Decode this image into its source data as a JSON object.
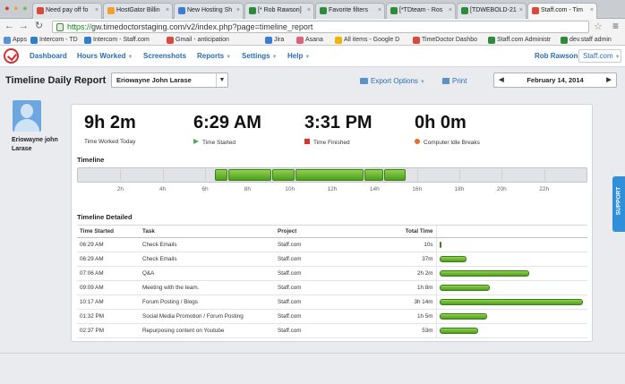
{
  "tabs": [
    {
      "label": "Need pay off fo",
      "color": "#d94a3a",
      "active": false
    },
    {
      "label": "HostGator Billin",
      "color": "#f0a030",
      "active": false
    },
    {
      "label": "New Hosting Sh",
      "color": "#3b7bd6",
      "active": false
    },
    {
      "label": "[* Rob Rawson]",
      "color": "#2e8b3e",
      "active": false
    },
    {
      "label": "Favorite filters",
      "color": "#2e8b3e",
      "active": false
    },
    {
      "label": "[*TDteam - Ros",
      "color": "#2e8b3e",
      "active": false
    },
    {
      "label": "[TDWEBOLD-21",
      "color": "#2e8b3e",
      "active": false
    },
    {
      "label": "Staff.com - Tim",
      "color": "#d94a3a",
      "active": true
    }
  ],
  "address": {
    "scheme": "https://",
    "url": "gw.timedoctorstaging.com/v2/index.php?page=timeline_report"
  },
  "bookmarks": [
    {
      "label": "Apps",
      "color": "#5b8fd6"
    },
    {
      "label": "Intercom - TD",
      "color": "#2f7fcf"
    },
    {
      "label": "Intercom - Staff.com",
      "color": "#2f7fcf"
    },
    {
      "label": "Gmail - anticipation",
      "color": "#d94a3a"
    },
    {
      "label": "Jira",
      "color": "#3b7bd6"
    },
    {
      "label": "Asana",
      "color": "#e0607a"
    },
    {
      "label": "All items - Google D",
      "color": "#f0b400"
    },
    {
      "label": "TimeDoctor Dashbo",
      "color": "#d94a3a"
    },
    {
      "label": "Staff.com Administr",
      "color": "#2e8b3e"
    },
    {
      "label": "dev.staff admin",
      "color": "#2e8b3e"
    }
  ],
  "nav": {
    "items": [
      "Dashboard",
      "Hours Worked",
      "Screenshots",
      "Reports",
      "Settings",
      "Help"
    ],
    "user": "Rob Rawson",
    "org": "Staff.com"
  },
  "report": {
    "title": "Timeline Daily Report",
    "selected_user": "Eriowayne John Larase",
    "export_label": "Export Options",
    "print_label": "Print",
    "date": "February 14, 2014"
  },
  "profile": {
    "name": "Eriowayne john Larase"
  },
  "stats": [
    {
      "value": "9h 2m",
      "label": "Time Worked Today",
      "marker": "none"
    },
    {
      "value": "6:29 AM",
      "label": "Time Started",
      "marker": "triangle"
    },
    {
      "value": "3:31 PM",
      "label": "Time Finished",
      "marker": "square"
    },
    {
      "value": "0h 0m",
      "label": "Computer Idle Breaks",
      "marker": "dot"
    }
  ],
  "timeline": {
    "title": "Timeline",
    "ticks": [
      "2h",
      "4h",
      "6h",
      "8h",
      "10h",
      "12h",
      "14h",
      "16h",
      "18h",
      "20h",
      "22h"
    ],
    "range_hours": [
      0,
      24
    ],
    "segments": [
      {
        "start": 6.48,
        "end": 7.1
      },
      {
        "start": 7.1,
        "end": 9.15
      },
      {
        "start": 9.15,
        "end": 10.28
      },
      {
        "start": 10.28,
        "end": 13.53
      },
      {
        "start": 13.53,
        "end": 14.45
      },
      {
        "start": 14.45,
        "end": 15.52
      }
    ]
  },
  "detail": {
    "title": "Timeline Detailed",
    "columns": [
      "Time Started",
      "Task",
      "Project",
      "Total Time"
    ],
    "rows": [
      {
        "start": "06:29 AM",
        "task": "Check Emails",
        "project": "Staff.com",
        "total": "10s",
        "fraction": 0.005
      },
      {
        "start": "06:29 AM",
        "task": "Check Emails",
        "project": "Staff.com",
        "total": "37m",
        "fraction": 0.19
      },
      {
        "start": "07:06 AM",
        "task": "Q&A",
        "project": "Staff.com",
        "total": "2h 2m",
        "fraction": 0.62
      },
      {
        "start": "09:09 AM",
        "task": "Meeting with the team.",
        "project": "Staff.com",
        "total": "1h 8m",
        "fraction": 0.35
      },
      {
        "start": "10:17 AM",
        "task": "Forum Posting / Blogs",
        "project": "Staff.com",
        "total": "3h 14m",
        "fraction": 0.99
      },
      {
        "start": "01:32 PM",
        "task": "Social Media Promotion / Forum Posting",
        "project": "Staff.com",
        "total": "1h 5m",
        "fraction": 0.33
      },
      {
        "start": "02:37 PM",
        "task": "Repurposing content on Youtube",
        "project": "Staff.com",
        "total": "53m",
        "fraction": 0.27
      }
    ]
  },
  "support_label": "SUPPORT"
}
